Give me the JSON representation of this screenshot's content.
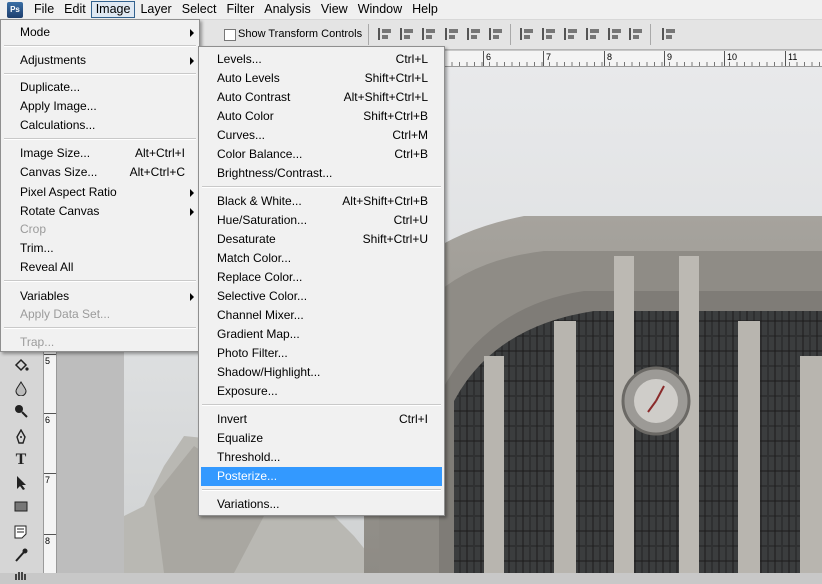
{
  "menubar": {
    "logo_text": "Ps",
    "items": [
      "File",
      "Edit",
      "Image",
      "Layer",
      "Select",
      "Filter",
      "Analysis",
      "View",
      "Window",
      "Help"
    ],
    "active_index": 2
  },
  "options_bar": {
    "show_transform_controls_label": "Show Transform Controls",
    "show_transform_controls_checked": false
  },
  "ruler": {
    "top_numbers": [
      "6",
      "7",
      "8",
      "9",
      "10",
      "11"
    ],
    "left_numbers": [
      "5",
      "6",
      "7",
      "8"
    ]
  },
  "image_menu": {
    "items": [
      {
        "label": "Mode",
        "shortcut": "",
        "submenu": true,
        "disabled": false
      },
      {
        "label": "Adjustments",
        "shortcut": "",
        "submenu": true,
        "disabled": false
      },
      {
        "label": "Duplicate...",
        "shortcut": "",
        "submenu": false,
        "disabled": false
      },
      {
        "label": "Apply Image...",
        "shortcut": "",
        "submenu": false,
        "disabled": false
      },
      {
        "label": "Calculations...",
        "shortcut": "",
        "submenu": false,
        "disabled": false
      },
      {
        "label": "Image Size...",
        "shortcut": "Alt+Ctrl+I",
        "submenu": false,
        "disabled": false
      },
      {
        "label": "Canvas Size...",
        "shortcut": "Alt+Ctrl+C",
        "submenu": false,
        "disabled": false
      },
      {
        "label": "Pixel Aspect Ratio",
        "shortcut": "",
        "submenu": true,
        "disabled": false
      },
      {
        "label": "Rotate Canvas",
        "shortcut": "",
        "submenu": true,
        "disabled": false
      },
      {
        "label": "Crop",
        "shortcut": "",
        "submenu": false,
        "disabled": true
      },
      {
        "label": "Trim...",
        "shortcut": "",
        "submenu": false,
        "disabled": false
      },
      {
        "label": "Reveal All",
        "shortcut": "",
        "submenu": false,
        "disabled": false
      },
      {
        "label": "Variables",
        "shortcut": "",
        "submenu": true,
        "disabled": false
      },
      {
        "label": "Apply Data Set...",
        "shortcut": "",
        "submenu": false,
        "disabled": true
      },
      {
        "label": "Trap...",
        "shortcut": "",
        "submenu": false,
        "disabled": true
      }
    ]
  },
  "adjustments_menu": {
    "items": [
      {
        "label": "Levels...",
        "shortcut": "Ctrl+L"
      },
      {
        "label": "Auto Levels",
        "shortcut": "Shift+Ctrl+L"
      },
      {
        "label": "Auto Contrast",
        "shortcut": "Alt+Shift+Ctrl+L"
      },
      {
        "label": "Auto Color",
        "shortcut": "Shift+Ctrl+B"
      },
      {
        "label": "Curves...",
        "shortcut": "Ctrl+M"
      },
      {
        "label": "Color Balance...",
        "shortcut": "Ctrl+B"
      },
      {
        "label": "Brightness/Contrast...",
        "shortcut": ""
      },
      {
        "label": "Black & White...",
        "shortcut": "Alt+Shift+Ctrl+B"
      },
      {
        "label": "Hue/Saturation...",
        "shortcut": "Ctrl+U"
      },
      {
        "label": "Desaturate",
        "shortcut": "Shift+Ctrl+U"
      },
      {
        "label": "Match Color...",
        "shortcut": ""
      },
      {
        "label": "Replace Color...",
        "shortcut": ""
      },
      {
        "label": "Selective Color...",
        "shortcut": ""
      },
      {
        "label": "Channel Mixer...",
        "shortcut": ""
      },
      {
        "label": "Gradient Map...",
        "shortcut": ""
      },
      {
        "label": "Photo Filter...",
        "shortcut": ""
      },
      {
        "label": "Shadow/Highlight...",
        "shortcut": ""
      },
      {
        "label": "Exposure...",
        "shortcut": ""
      },
      {
        "label": "Invert",
        "shortcut": "Ctrl+I"
      },
      {
        "label": "Equalize",
        "shortcut": ""
      },
      {
        "label": "Threshold...",
        "shortcut": ""
      },
      {
        "label": "Posterize...",
        "shortcut": ""
      },
      {
        "label": "Variations...",
        "shortcut": ""
      }
    ],
    "highlighted_index": 21
  },
  "toolbox": {
    "tools": [
      "paint-bucket-icon",
      "blur-drop-icon",
      "dodge-icon",
      "pen-icon",
      "type-icon",
      "path-select-icon",
      "rectangle-shape-icon",
      "notes-icon",
      "eyedropper-icon",
      "hand-icon"
    ]
  },
  "colors": {
    "menu_bg": "#f1f1f1",
    "highlight": "#3399ff",
    "disabled_text": "#9b9b9b"
  }
}
